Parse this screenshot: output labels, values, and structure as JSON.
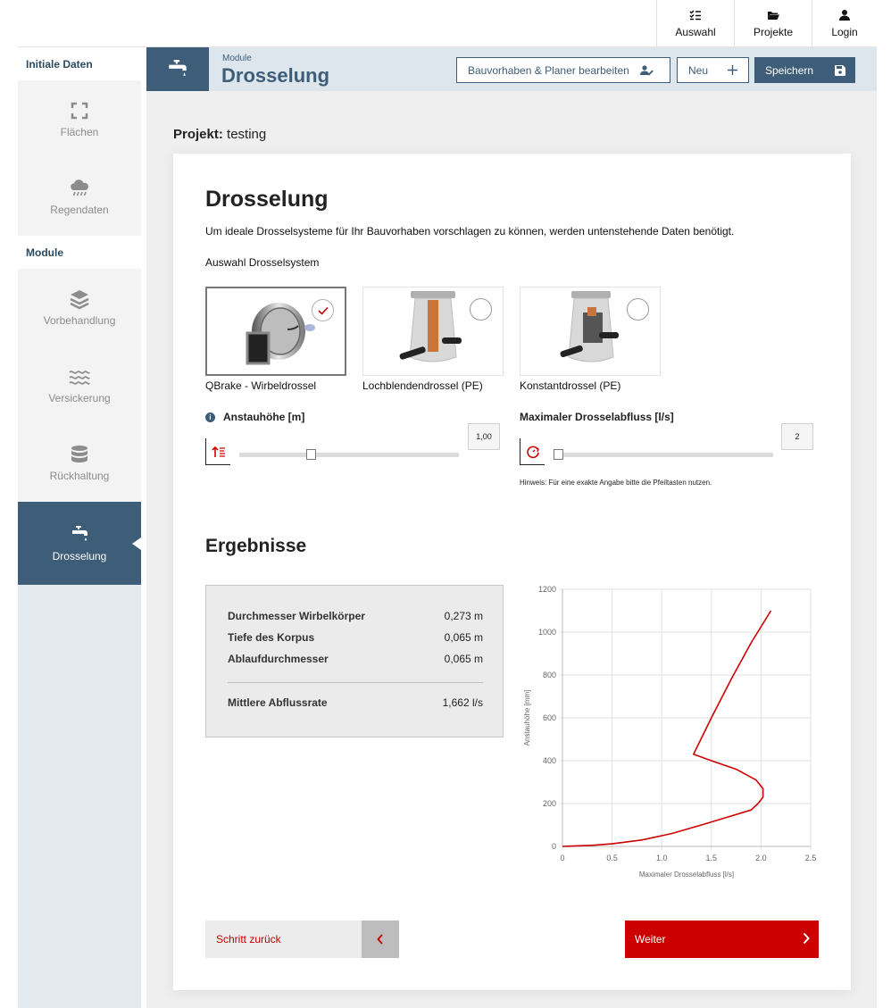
{
  "topnav": [
    {
      "label": "Auswahl",
      "icon": "checklist-icon"
    },
    {
      "label": "Projekte",
      "icon": "folder-open-icon"
    },
    {
      "label": "Login",
      "icon": "user-icon"
    }
  ],
  "sidebar": {
    "section_initial": "Initiale Daten",
    "section_modules": "Module",
    "items": [
      {
        "label": "Flächen",
        "icon": "area-frame-icon"
      },
      {
        "label": "Regendaten",
        "icon": "rain-cloud-icon"
      },
      {
        "label": "Vorbehandlung",
        "icon": "layers-icon"
      },
      {
        "label": "Versickerung",
        "icon": "waves-icon"
      },
      {
        "label": "Rückhaltung",
        "icon": "database-icon"
      },
      {
        "label": "Drosselung",
        "icon": "faucet-icon",
        "active": true
      }
    ]
  },
  "module_header": {
    "subtitle": "Module",
    "title": "Drosselung",
    "edit_button": "Bauvorhaben & Planer bearbeiten",
    "new_button": "Neu",
    "save_button": "Speichern"
  },
  "project": {
    "label": "Projekt:",
    "name": "testing"
  },
  "card": {
    "title": "Drosselung",
    "description": "Um ideale Drosselsysteme für Ihr Bauvorhaben vorschlagen zu können, werden untenstehende Daten benötigt.",
    "selection_label": "Auswahl Drosselsystem",
    "options": [
      {
        "label": "QBrake - Wirbeldrossel",
        "selected": true
      },
      {
        "label": "Lochblendendrossel (PE)",
        "selected": false
      },
      {
        "label": "Konstantdrossel (PE)",
        "selected": false
      }
    ],
    "slider_height": {
      "label": "Anstauhöhe [m]",
      "value": "1,00",
      "fraction": 0.32
    },
    "slider_flow": {
      "label": "Maximaler Drosselabfluss [l/s]",
      "value": "2",
      "fraction": 0.0
    },
    "hint": "Hinweis: Für eine exakte Angabe bitte die Pfeiltasten nutzen.",
    "results_title": "Ergebnisse",
    "results": [
      {
        "label": "Durchmesser Wirbelkörper",
        "value": "0,273 m"
      },
      {
        "label": "Tiefe des Korpus",
        "value": "0,065 m"
      },
      {
        "label": "Ablaufdurchmesser",
        "value": "0,065 m"
      }
    ],
    "result_total": {
      "label": "Mittlere Abflussrate",
      "value": "1,662 l/s"
    },
    "back_button": "Schritt zurück",
    "next_button": "Weiter"
  },
  "colors": {
    "primary": "#3d5d78",
    "accent": "#cc0000",
    "curve": "#cc0000"
  },
  "chart_data": {
    "type": "line",
    "xlabel": "Maximaler Drosselabfluss [l/s]",
    "ylabel": "Anstauhöhe [mm]",
    "xlim": [
      0,
      2.5
    ],
    "ylim": [
      0,
      1200
    ],
    "xticks": [
      "0",
      "0.5",
      "1.0",
      "1.5",
      "2.0",
      "2.5"
    ],
    "yticks": [
      "0",
      "200",
      "400",
      "600",
      "800",
      "1000",
      "1200"
    ],
    "grid": true,
    "series": [
      {
        "x": [
          0,
          0.3,
          0.5,
          0.8,
          1.1,
          1.4,
          1.65,
          1.9,
          1.97,
          2.02,
          2.02,
          1.95,
          1.75,
          1.5,
          1.32,
          1.5,
          1.7,
          1.9,
          2.1
        ],
        "y": [
          0,
          5,
          12,
          30,
          60,
          100,
          135,
          170,
          200,
          230,
          270,
          310,
          360,
          400,
          430,
          600,
          780,
          950,
          1100
        ]
      }
    ]
  }
}
